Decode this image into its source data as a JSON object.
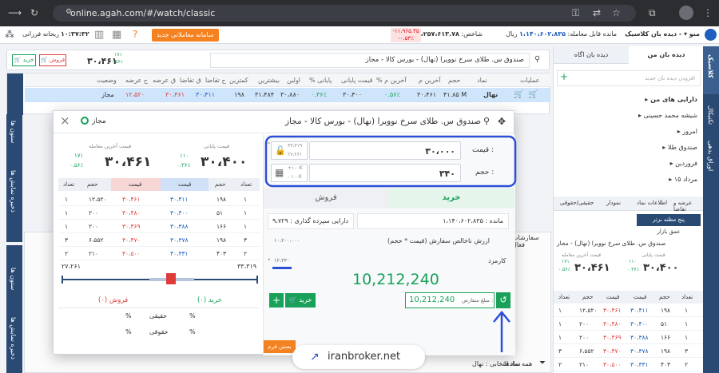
{
  "browser": {
    "url": "online.agah.com/#/watch/classic"
  },
  "header": {
    "app_title": "دیده بان کلاسیک",
    "menu_label": "منو",
    "tradable_label": "مانده قابل معامله:",
    "tradable_value": "۱،۱۴۰،۶۰۲،۸۳۵",
    "tradable_unit": "ریال",
    "index_label": "شاخص:",
    "index_value": "۲،۲۵۷،۶۱۳.۷۸",
    "index_change": "-۱۱،۹۶۵.۳۵",
    "index_percent": "-۰.۵۳٪",
    "new_system_button": "سامانه معاملاتی جدید",
    "clock": "۱۰:۳۷:۳۲",
    "flipper_label": "ریحانه فرزانی"
  },
  "toolbar": {
    "symbol_search": "صندوق س. طلای سرخ نوویرا (نهال) - بورس کالا - مجاز",
    "buy_label": "خرید",
    "sell_label": "فروش",
    "last_price": "۳۰،۴۶۱",
    "last_change": "۱۷۱",
    "last_percent": "۰.۵۶٪"
  },
  "watch": {
    "headers": [
      "عملیات",
      "نماد",
      "حجم",
      "آخرین م",
      "% آخرین م",
      "قیمت پایانی",
      "% پایانی",
      "اولین",
      "بیشترین",
      "کمترین",
      "ح تقاضا",
      "ق تقاضا",
      "ق عرضه",
      "ح عرضه",
      "وضعیت"
    ],
    "rows": [
      {
        "symbol": "نهال",
        "volume": "۴۱.۸۵ M",
        "last": "۳۰،۴۶۱",
        "last_pct": "۰.۵۶٪",
        "close": "۳۰،۴۰۰",
        "close_pct": "۰.۳۶٪",
        "first": "۳۰،۸۸۰",
        "high": "۳۱،۴۸۴",
        "low": "۱۹۸",
        "bid_vol": "۳۰،۴۱۱",
        "bid": "۳۰،۴۶۱",
        "ask": "۱۲،۵۲۰",
        "status": "مجاز"
      }
    ],
    "left_tab_labels": [
      "ستون ها",
      "ذخیره نمایش ها"
    ]
  },
  "modal": {
    "title": "صندوق س. طلای سرخ نوویرا (نهال) - بورس کالا - مجاز",
    "status": "مجاز",
    "price_label": "قیمت :",
    "price_value": "۳۰،۰۰۰",
    "price_upper": "۳۳،۳۱۹",
    "price_lower": "۲۷،۲۶۱",
    "volume_label": "حجم :",
    "volume_value": "۳۴۰",
    "volume_step_up": "+۱۰۰K",
    "volume_step_down": "- ۱۰۰K",
    "tab_buy": "خرید",
    "tab_sell": "فروش",
    "remaining_label": "مانده :",
    "remaining_value": "۱،۱۴۰،۶۰۲،۸۳۵",
    "portfolio_label": "دارایی سپرده گذاری :",
    "portfolio_value": "۹،۷۲۹",
    "gross_label": "ارزش ناخالص سفارش (قیمت * حجم)",
    "gross_value": "۱۰،۲۰۰،۰۰۰",
    "fee_label": "کارمزد",
    "fee_value": "۱۲،۲۴۰",
    "total_big": "10,212,240",
    "order_amount_label": "مبلغ سفارش :",
    "order_amount_value": "10,212,240",
    "buy_button": "خرید",
    "close_price_label": "قیمت پایانی",
    "close_price": "۳۰،۴۰۰",
    "close_change": "۱۱۰",
    "close_pct": "۰.۳۶٪",
    "last_price_label": "قیمت آخرین معامله",
    "last_price": "۳۰،۴۶۱",
    "last_change": "۱۷۱",
    "last_pct": "۰.۵۶٪",
    "ob_headers": [
      "تعداد",
      "حجم",
      "قیمت",
      "قیمت",
      "حجم",
      "تعداد"
    ],
    "orderbook": [
      [
        "۱",
        "۱۹۸",
        "۳۰،۴۱۱",
        "۳۰،۴۶۱",
        "۱۲،۵۲۰",
        "۱"
      ],
      [
        "۱",
        "۵۱",
        "۳۰،۴۰۰",
        "۳۰،۴۸۰",
        "۲۰۰",
        "۱"
      ],
      [
        "۱",
        "۱۶۶",
        "۳۰،۳۸۸",
        "۳۰،۴۶۹",
        "۲۰۰",
        "۱"
      ],
      [
        "۳",
        "۱۹۸",
        "۳۰،۳۷۸",
        "۳۰،۴۷۰",
        "۶،۵۵۲",
        "۳"
      ],
      [
        "۲",
        "۴۰۳",
        "۳۰،۳۳۱",
        "۳۰،۵۰۰",
        "۲۱۰",
        "۲"
      ]
    ],
    "range_low": "۲۷،۲۶۱",
    "range_high": "۳۳،۳۱۹",
    "buy_count": "خرید (۰)",
    "sell_count": "فروش (۰)",
    "legal_label": "حقوقی",
    "real_label": "حقیقی",
    "pct_sign": "%",
    "close_form_button": "بستن فرم"
  },
  "right": {
    "tabs": [
      "دیده بان من",
      "دیده بان اگاه"
    ],
    "add_placeholder": "افزودن دیده بان جدید",
    "group": "دارایی های من",
    "items": [
      "شیشه محمد حسینی",
      "امروز",
      "صندوق طلا",
      "فروردین",
      "مرداد ۱۵"
    ],
    "detail_tabs": [
      "عرضه و تقاضا",
      "اطلاعات نماد",
      "نمودار",
      "حقیقی/حقوقی"
    ],
    "sub_tabs": [
      "پنج مظنه برتر",
      "عمق بازار"
    ],
    "symbol": "صندوق س. طلای سرخ نوویرا (نهال) - مجاز",
    "close_label": "قیمت پایانی",
    "close": "۳۰،۴۰۰",
    "close_change": "۱۱۰",
    "close_pct": "۰.۳۶٪",
    "last_label": "قیمت آخرین معامله",
    "last": "۳۰،۴۶۱",
    "last_change": "۱۷۱",
    "last_pct": "۰.۵۶٪",
    "ob_headers": [
      "تعداد",
      "حجم",
      "قیمت",
      "قیمت",
      "حجم",
      "تعداد"
    ]
  },
  "sidebar": {
    "tabs": [
      "کلاسیک",
      "تکنیکال",
      "اوراق بدهی"
    ]
  },
  "bottom": {
    "orders_label": "سفارشات فعال",
    "filter_label": "همه نمادها",
    "selected_symbol": "نماد انتخابی : نهال",
    "buy": "خرید"
  },
  "watermark": "iranbroker.net",
  "colors": {
    "accent": "#f58220",
    "highlight": "#2d4fd6",
    "buy": "#19a15a",
    "sell": "#e03b3b"
  }
}
